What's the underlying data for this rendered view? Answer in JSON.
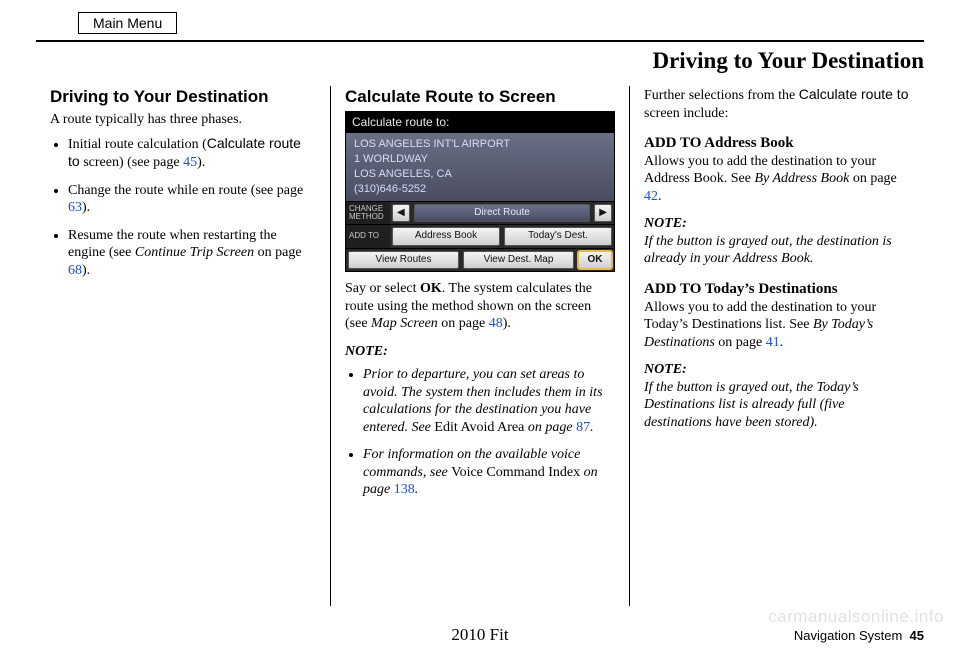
{
  "mainMenu": "Main Menu",
  "pageTitle": "Driving to Your Destination",
  "col1": {
    "heading": "Driving to Your Destination",
    "intro": "A route typically has three phases.",
    "items": [
      {
        "pre": "Initial route calculation (",
        "sans": "Calculate route to",
        "post1": " screen) (see page ",
        "page": "45",
        "post2": ")."
      },
      {
        "pre": "Change the route while en route (see page ",
        "page": "63",
        "post": ")."
      },
      {
        "pre": "Resume the route when restarting the engine (see ",
        "ital": "Continue Trip Screen",
        "post1": " on page ",
        "page": "68",
        "post2": ")."
      }
    ]
  },
  "col2": {
    "heading": "Calculate Route to Screen",
    "nav": {
      "title": "Calculate route to:",
      "addr": [
        "LOS ANGELES INT'L AIRPORT",
        "1 WORLDWAY",
        "LOS ANGELES, CA",
        "(310)646-5252"
      ],
      "changeLabel": "CHANGE METHOD",
      "addToLabel": "ADD TO",
      "directRoute": "Direct Route",
      "addressBook": "Address Book",
      "todaysDest": "Today's Dest.",
      "viewRoutes": "View Routes",
      "viewDestMap": "View Dest. Map",
      "ok": "OK",
      "arrowLeft": "◀",
      "arrowRight": "▶"
    },
    "afterNav": {
      "pre": "Say or select ",
      "bold": "OK",
      "post": ". The system calculates the route using the method shown on the screen (see ",
      "ital": "Map Screen",
      "post2": " on page ",
      "page": "48",
      "post3": ")."
    },
    "noteLabel": "NOTE:",
    "notes": [
      {
        "ital1": "Prior to departure, you can set areas to avoid. The system then includes them in its calculations for the destination you have entered. See ",
        "roman": "Edit Avoid Area",
        "ital2": " on page ",
        "page": "87",
        "ital3": "."
      },
      {
        "ital1": "For information on the available voice commands, see ",
        "roman": "Voice Command Index",
        "ital2": " on page ",
        "page": "138",
        "ital3": "."
      }
    ]
  },
  "col3": {
    "lead": {
      "pre": "Further selections from the ",
      "sans": "Calculate route to",
      "post": " screen include:"
    },
    "addBook": {
      "head": "ADD TO Address Book",
      "text1": "Allows you to add the destination to your Address Book. See ",
      "ital": "By Address Book",
      "text2": " on page ",
      "page": "42",
      "text3": "."
    },
    "note1Label": "NOTE:",
    "note1": "If the button is grayed out, the destination is already in your Address Book.",
    "addToday": {
      "head": "ADD TO Today’s Destinations",
      "text1": "Allows you to add the destination to your Today’s Destinations list. See ",
      "ital": "By Today’s Destinations",
      "text2": " on page ",
      "page": "41",
      "text3": "."
    },
    "note2Label": "NOTE:",
    "note2": "If the button is grayed out, the Today’s Destinations list is already full (five destinations have been stored)."
  },
  "footer": {
    "model": "2010 Fit",
    "section": "Navigation System",
    "page": "45"
  },
  "watermark": "carmanualsonline.info"
}
